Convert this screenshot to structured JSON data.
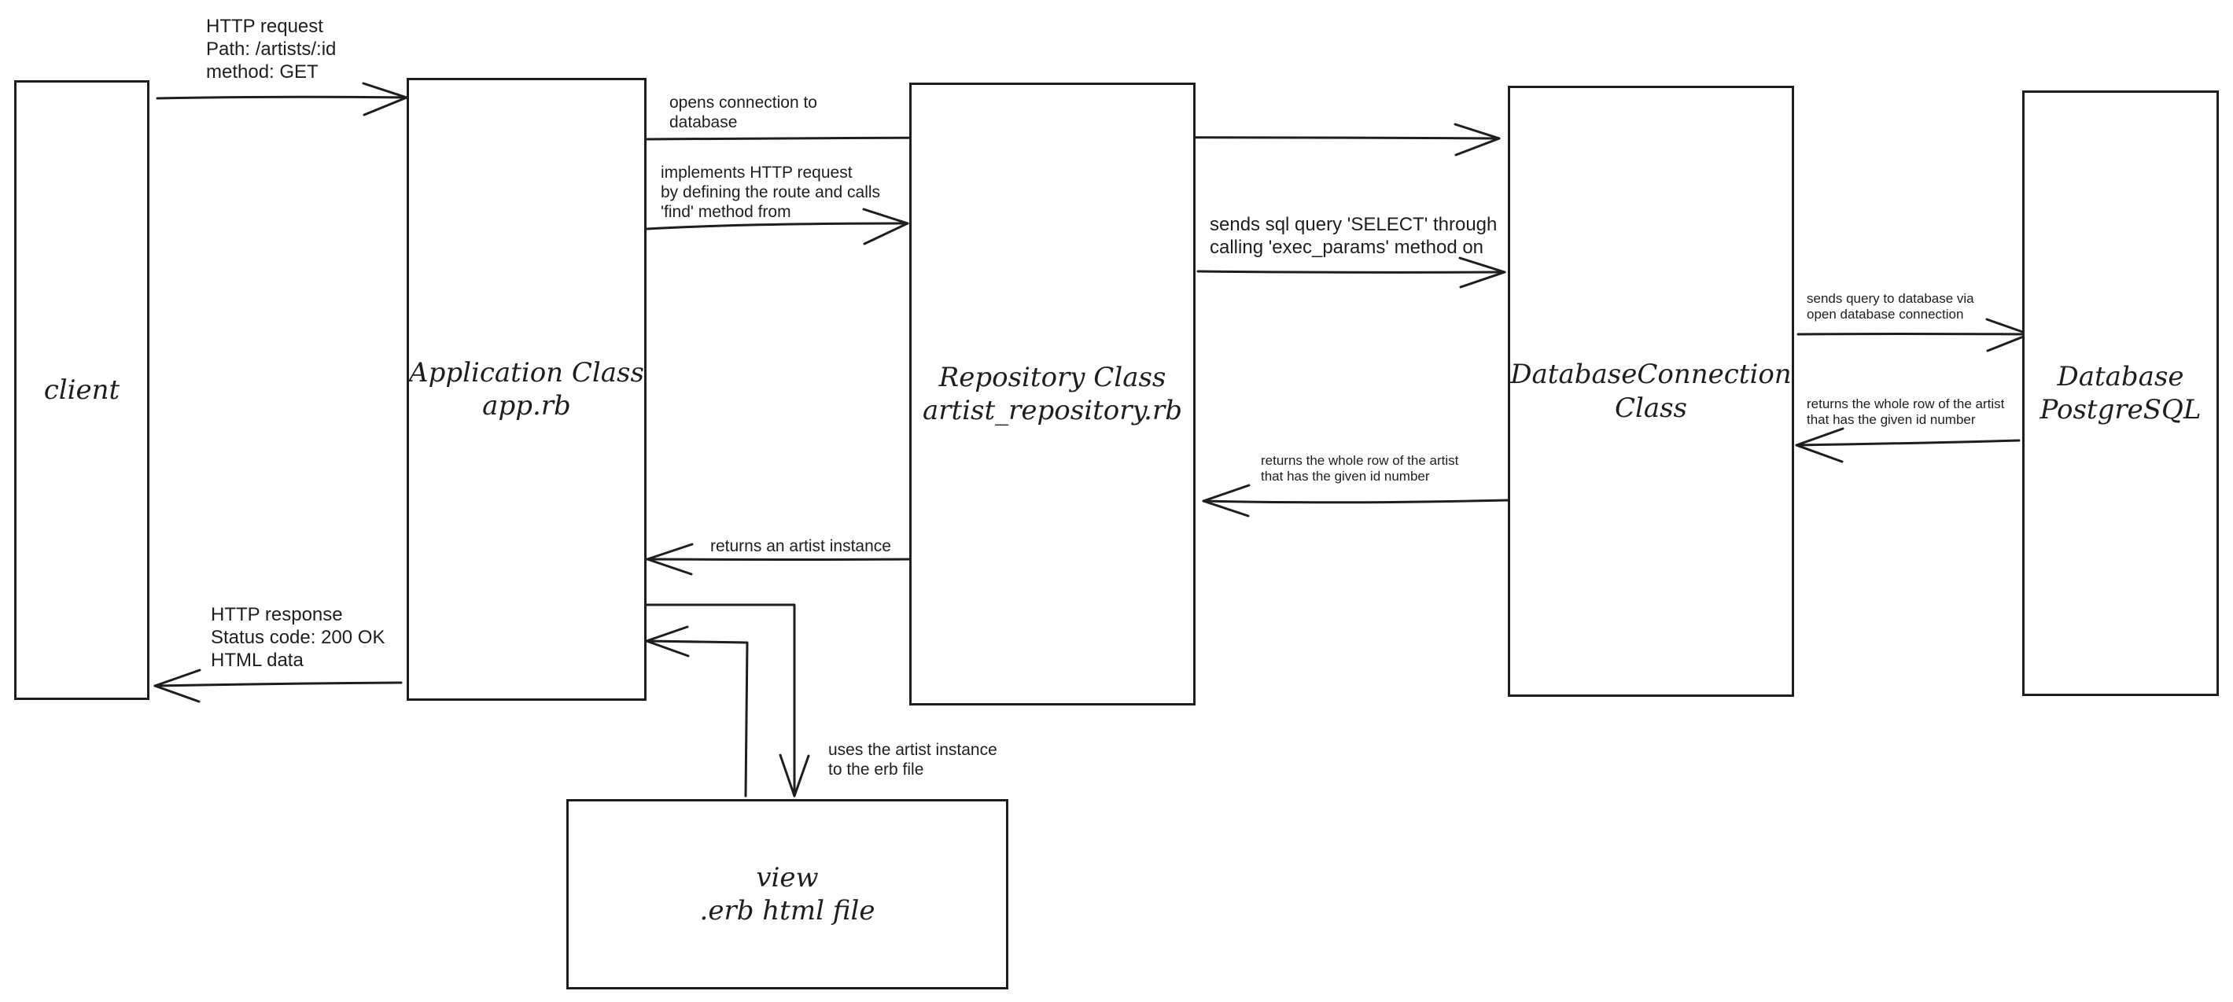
{
  "diagram": {
    "nodes": {
      "client": {
        "label": "client"
      },
      "application": {
        "label": "Application Class\napp.rb"
      },
      "repository": {
        "label": "Repository Class\nartist_repository.rb"
      },
      "db_connection": {
        "label": "DatabaseConnection\nClass"
      },
      "database": {
        "label": "Database\nPostgreSQL"
      },
      "view": {
        "label": "view\n.erb html file"
      }
    },
    "edges": {
      "http_request": {
        "label": "HTTP request\nPath: /artists/:id\nmethod: GET"
      },
      "opens_connection": {
        "label": "opens connection to\ndatabase"
      },
      "implements_request": {
        "label": "implements HTTP request\nby defining the route and calls\n'find' method from"
      },
      "sends_sql": {
        "label": "sends sql query 'SELECT' through\ncalling 'exec_params' method on"
      },
      "sends_query_db": {
        "label": "sends query to database via\nopen database connection"
      },
      "returns_row_db": {
        "label": "returns the whole row of the artist\nthat has the given id number"
      },
      "returns_row_conn": {
        "label": "returns the whole row of the artist\nthat has the given id number"
      },
      "returns_instance": {
        "label": "returns an artist instance"
      },
      "http_response": {
        "label": "HTTP response\nStatus code: 200 OK\nHTML data"
      },
      "uses_instance": {
        "label": "uses the artist instance\nto the erb file"
      }
    }
  }
}
